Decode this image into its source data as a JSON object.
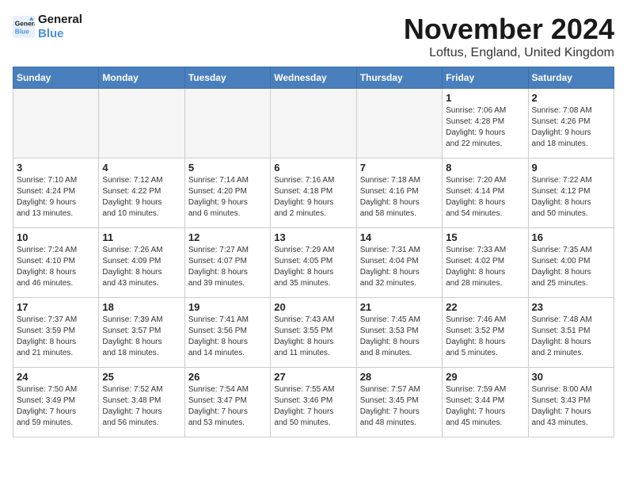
{
  "header": {
    "logo_line1": "General",
    "logo_line2": "Blue",
    "month_title": "November 2024",
    "location": "Loftus, England, United Kingdom"
  },
  "weekdays": [
    "Sunday",
    "Monday",
    "Tuesday",
    "Wednesday",
    "Thursday",
    "Friday",
    "Saturday"
  ],
  "weeks": [
    [
      {
        "day": "",
        "info": ""
      },
      {
        "day": "",
        "info": ""
      },
      {
        "day": "",
        "info": ""
      },
      {
        "day": "",
        "info": ""
      },
      {
        "day": "",
        "info": ""
      },
      {
        "day": "1",
        "info": "Sunrise: 7:06 AM\nSunset: 4:28 PM\nDaylight: 9 hours\nand 22 minutes."
      },
      {
        "day": "2",
        "info": "Sunrise: 7:08 AM\nSunset: 4:26 PM\nDaylight: 9 hours\nand 18 minutes."
      }
    ],
    [
      {
        "day": "3",
        "info": "Sunrise: 7:10 AM\nSunset: 4:24 PM\nDaylight: 9 hours\nand 13 minutes."
      },
      {
        "day": "4",
        "info": "Sunrise: 7:12 AM\nSunset: 4:22 PM\nDaylight: 9 hours\nand 10 minutes."
      },
      {
        "day": "5",
        "info": "Sunrise: 7:14 AM\nSunset: 4:20 PM\nDaylight: 9 hours\nand 6 minutes."
      },
      {
        "day": "6",
        "info": "Sunrise: 7:16 AM\nSunset: 4:18 PM\nDaylight: 9 hours\nand 2 minutes."
      },
      {
        "day": "7",
        "info": "Sunrise: 7:18 AM\nSunset: 4:16 PM\nDaylight: 8 hours\nand 58 minutes."
      },
      {
        "day": "8",
        "info": "Sunrise: 7:20 AM\nSunset: 4:14 PM\nDaylight: 8 hours\nand 54 minutes."
      },
      {
        "day": "9",
        "info": "Sunrise: 7:22 AM\nSunset: 4:12 PM\nDaylight: 8 hours\nand 50 minutes."
      }
    ],
    [
      {
        "day": "10",
        "info": "Sunrise: 7:24 AM\nSunset: 4:10 PM\nDaylight: 8 hours\nand 46 minutes."
      },
      {
        "day": "11",
        "info": "Sunrise: 7:26 AM\nSunset: 4:09 PM\nDaylight: 8 hours\nand 43 minutes."
      },
      {
        "day": "12",
        "info": "Sunrise: 7:27 AM\nSunset: 4:07 PM\nDaylight: 8 hours\nand 39 minutes."
      },
      {
        "day": "13",
        "info": "Sunrise: 7:29 AM\nSunset: 4:05 PM\nDaylight: 8 hours\nand 35 minutes."
      },
      {
        "day": "14",
        "info": "Sunrise: 7:31 AM\nSunset: 4:04 PM\nDaylight: 8 hours\nand 32 minutes."
      },
      {
        "day": "15",
        "info": "Sunrise: 7:33 AM\nSunset: 4:02 PM\nDaylight: 8 hours\nand 28 minutes."
      },
      {
        "day": "16",
        "info": "Sunrise: 7:35 AM\nSunset: 4:00 PM\nDaylight: 8 hours\nand 25 minutes."
      }
    ],
    [
      {
        "day": "17",
        "info": "Sunrise: 7:37 AM\nSunset: 3:59 PM\nDaylight: 8 hours\nand 21 minutes."
      },
      {
        "day": "18",
        "info": "Sunrise: 7:39 AM\nSunset: 3:57 PM\nDaylight: 8 hours\nand 18 minutes."
      },
      {
        "day": "19",
        "info": "Sunrise: 7:41 AM\nSunset: 3:56 PM\nDaylight: 8 hours\nand 14 minutes."
      },
      {
        "day": "20",
        "info": "Sunrise: 7:43 AM\nSunset: 3:55 PM\nDaylight: 8 hours\nand 11 minutes."
      },
      {
        "day": "21",
        "info": "Sunrise: 7:45 AM\nSunset: 3:53 PM\nDaylight: 8 hours\nand 8 minutes."
      },
      {
        "day": "22",
        "info": "Sunrise: 7:46 AM\nSunset: 3:52 PM\nDaylight: 8 hours\nand 5 minutes."
      },
      {
        "day": "23",
        "info": "Sunrise: 7:48 AM\nSunset: 3:51 PM\nDaylight: 8 hours\nand 2 minutes."
      }
    ],
    [
      {
        "day": "24",
        "info": "Sunrise: 7:50 AM\nSunset: 3:49 PM\nDaylight: 7 hours\nand 59 minutes."
      },
      {
        "day": "25",
        "info": "Sunrise: 7:52 AM\nSunset: 3:48 PM\nDaylight: 7 hours\nand 56 minutes."
      },
      {
        "day": "26",
        "info": "Sunrise: 7:54 AM\nSunset: 3:47 PM\nDaylight: 7 hours\nand 53 minutes."
      },
      {
        "day": "27",
        "info": "Sunrise: 7:55 AM\nSunset: 3:46 PM\nDaylight: 7 hours\nand 50 minutes."
      },
      {
        "day": "28",
        "info": "Sunrise: 7:57 AM\nSunset: 3:45 PM\nDaylight: 7 hours\nand 48 minutes."
      },
      {
        "day": "29",
        "info": "Sunrise: 7:59 AM\nSunset: 3:44 PM\nDaylight: 7 hours\nand 45 minutes."
      },
      {
        "day": "30",
        "info": "Sunrise: 8:00 AM\nSunset: 3:43 PM\nDaylight: 7 hours\nand 43 minutes."
      }
    ]
  ]
}
